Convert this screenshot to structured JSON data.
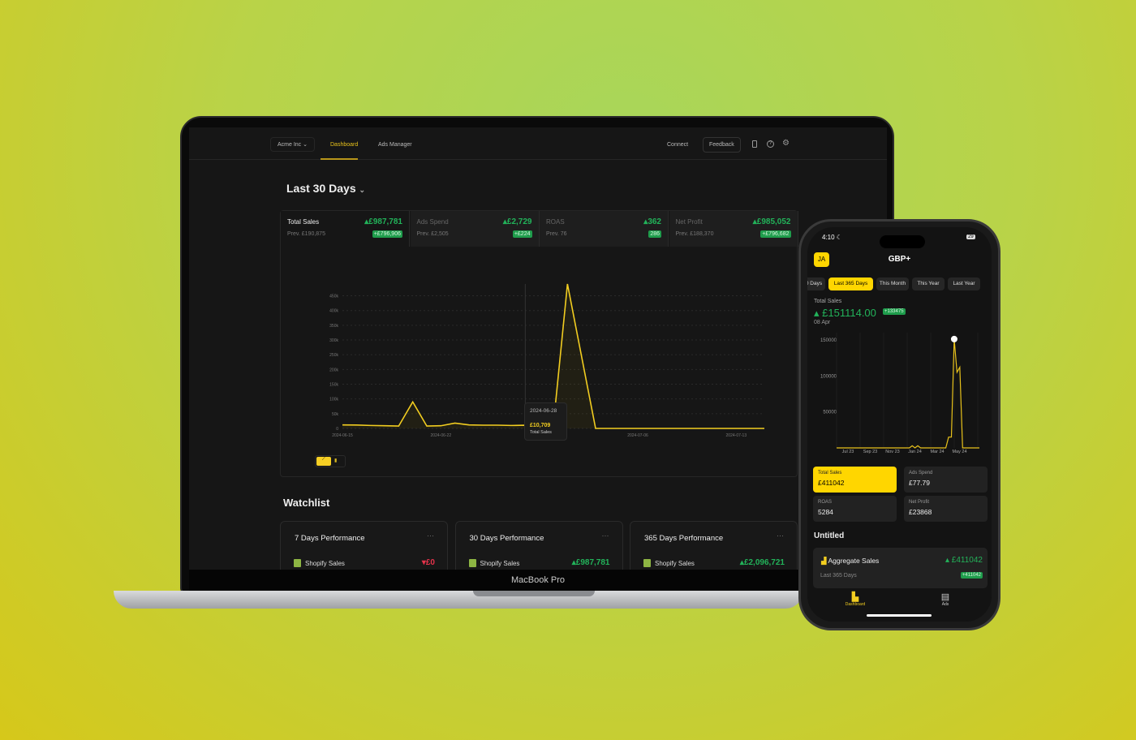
{
  "device_label": "MacBook Pro",
  "desktop": {
    "nav": {
      "org": "Acme Inc",
      "tabs": [
        {
          "label": "Dashboard",
          "active": true
        },
        {
          "label": "Ads Manager"
        }
      ],
      "connect": "Connect",
      "feedback": "Feedback",
      "icons": [
        "phone-icon",
        "help-icon",
        "gear-icon"
      ]
    },
    "title": "Last 30 Days",
    "stats": [
      {
        "label": "Total Sales",
        "value": "£987,781",
        "prev": "Prev. £190,875",
        "delta": "+£796,906",
        "active": true
      },
      {
        "label": "Ads Spend",
        "value": "£2,729",
        "prev": "Prev. £2,505",
        "delta": "+£224"
      },
      {
        "label": "ROAS",
        "value": "362",
        "prev": "Prev. 76",
        "delta": "286"
      },
      {
        "label": "Net Profit",
        "value": "£985,052",
        "prev": "Prev. £188,370",
        "delta": "+£796,682"
      }
    ],
    "tooltip": {
      "date": "2024-06-28",
      "value": "£10,709",
      "label": "Total Sales"
    },
    "watchlist": {
      "title": "Watchlist",
      "cards": [
        {
          "title": "7 Days Performance",
          "metric": "Shopify Sales",
          "value": "£0",
          "trend": "down"
        },
        {
          "title": "30 Days Performance",
          "metric": "Shopify Sales",
          "value": "£987,781",
          "trend": "up"
        },
        {
          "title": "365 Days Performance",
          "metric": "Shopify Sales",
          "value": "£2,096,721",
          "trend": "up"
        }
      ]
    }
  },
  "phone": {
    "time": "4:10",
    "battery": "29",
    "avatar": "JA",
    "title": "GBP+",
    "ranges": [
      {
        "label": "0 Days"
      },
      {
        "label": "Last 365 Days",
        "active": true
      },
      {
        "label": "This Month"
      },
      {
        "label": "This Year"
      },
      {
        "label": "Last Year"
      }
    ],
    "metric_label": "Total Sales",
    "metric_value": "£151114.00",
    "metric_delta": "+133475",
    "metric_date": "08 Apr",
    "cards": [
      {
        "label": "Total Sales",
        "value": "£411042",
        "active": true
      },
      {
        "label": "Ads Spend",
        "value": "£77.79"
      },
      {
        "label": "ROAS",
        "value": "5284"
      },
      {
        "label": "Net Profit",
        "value": "£23868"
      }
    ],
    "section": "Untitled",
    "aggregate": {
      "title": "Aggregate Sales",
      "value": "£411042",
      "sub": "Last 365 Days",
      "delta": "+411042"
    },
    "tabbar": [
      {
        "label": "Dashboard",
        "active": true
      },
      {
        "label": "Ads"
      }
    ]
  },
  "colors": {
    "accent": "#ffd600",
    "positive": "#22b35a",
    "negative": "#e5334b"
  },
  "chart_data": [
    {
      "type": "area",
      "series": [
        {
          "name": "Total Sales",
          "x": [
            "2024-06-15",
            "2024-06-16",
            "2024-06-17",
            "2024-06-18",
            "2024-06-19",
            "2024-06-20",
            "2024-06-21",
            "2024-06-22",
            "2024-06-23",
            "2024-06-24",
            "2024-06-25",
            "2024-06-26",
            "2024-06-27",
            "2024-06-28",
            "2024-06-29",
            "2024-06-30",
            "2024-07-01",
            "2024-07-02",
            "2024-07-03",
            "2024-07-04",
            "2024-07-05",
            "2024-07-06",
            "2024-07-07",
            "2024-07-08",
            "2024-07-09",
            "2024-07-10",
            "2024-07-11",
            "2024-07-12",
            "2024-07-13",
            "2024-07-14",
            "2024-07-15"
          ],
          "values": [
            12000,
            11500,
            10000,
            9000,
            8000,
            90000,
            8000,
            9000,
            18000,
            12000,
            11000,
            11000,
            10000,
            10709,
            10000,
            12000,
            490000,
            245000,
            0,
            0,
            0,
            0,
            0,
            0,
            0,
            0,
            0,
            0,
            0,
            0,
            0
          ]
        }
      ],
      "x_ticks": [
        "2024-06-15",
        "2024-06-22",
        "2024-06-29",
        "2024-07-06",
        "2024-07-13"
      ],
      "y_ticks": [
        "0",
        "50k",
        "100k",
        "150k",
        "200k",
        "250k",
        "300k",
        "350k",
        "400k",
        "450k"
      ],
      "ylim": [
        0,
        490000
      ],
      "grid": true
    },
    {
      "type": "line",
      "x_ticks": [
        "Jul 23",
        "Sep 23",
        "Nov 23",
        "Jan 24",
        "Mar 24",
        "May 24"
      ],
      "y_ticks": [
        "50000",
        "100000",
        "150000"
      ],
      "ylim": [
        0,
        160000
      ],
      "series": [
        {
          "values": [
            0,
            0,
            0,
            0,
            0,
            0,
            0,
            0,
            0,
            0,
            0,
            0,
            0,
            0,
            0,
            0,
            0,
            0,
            0,
            0,
            0,
            0,
            0,
            0,
            0,
            0,
            0,
            3000,
            0,
            3000,
            0,
            0,
            0,
            0,
            0,
            0,
            0,
            0,
            0,
            0,
            15000,
            15000,
            151114,
            105000,
            112000,
            0,
            0,
            0,
            0,
            0,
            0,
            0
          ]
        }
      ]
    }
  ]
}
